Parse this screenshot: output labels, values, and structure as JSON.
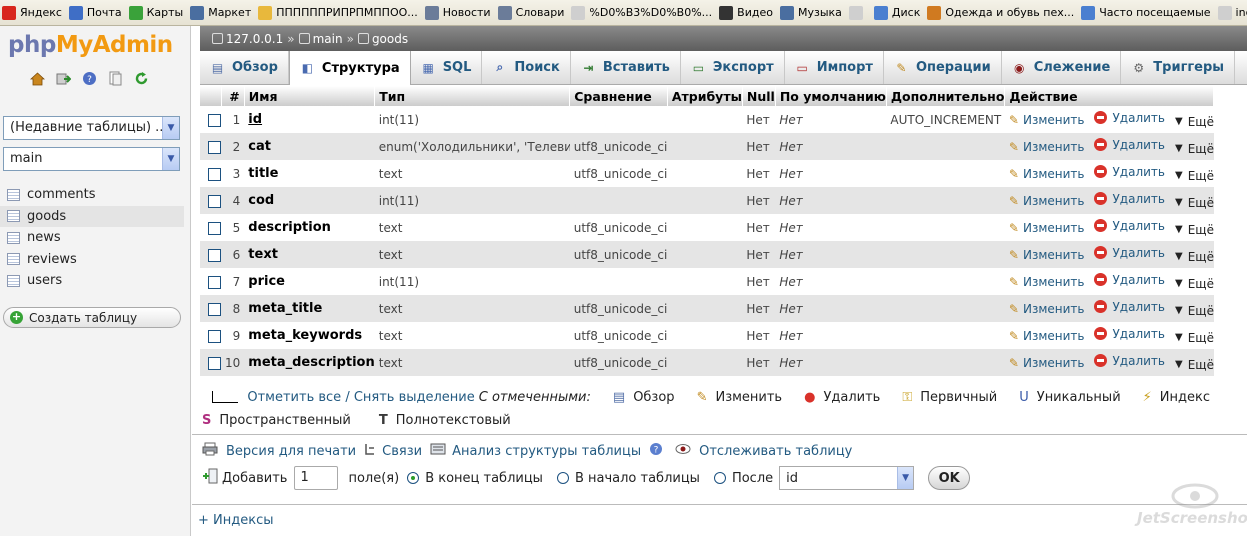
{
  "bookmarks": [
    {
      "label": "Яндекс",
      "color": "#d8261c"
    },
    {
      "label": "Почта",
      "color": "#3f6ec6"
    },
    {
      "label": "Карты",
      "color": "#3aa23a"
    },
    {
      "label": "Маркет",
      "color": "#4a6ea0"
    },
    {
      "label": "ППППППРИПРПМППОО...",
      "color": "#e8b83c"
    },
    {
      "label": "Новости",
      "color": "#6b7c99"
    },
    {
      "label": "Словари",
      "color": "#6b7c99"
    },
    {
      "label": "%D0%B3%D0%B0%...",
      "color": "#cfcfcf"
    },
    {
      "label": "Видео",
      "color": "#333333"
    },
    {
      "label": "Музыка",
      "color": "#4a6ea0"
    },
    {
      "label": "",
      "color": "#cfcfcf"
    },
    {
      "label": "Диск",
      "color": "#4a7fd0"
    },
    {
      "label": "Одежда и обувь пех...",
      "color": "#d07a20"
    },
    {
      "label": "Часто посещаемые",
      "color": "#4a7fd0"
    },
    {
      "label": "index.html",
      "color": "#cfcfcf"
    }
  ],
  "leftnav": {
    "logo_php": "php",
    "logo_admin": "MyAdmin",
    "recent_select": "(Недавние таблицы) ...",
    "db_select": "main",
    "tables": [
      "comments",
      "goods",
      "news",
      "reviews",
      "users"
    ],
    "active_table": "goods",
    "create_table": "Создать таблицу"
  },
  "breadcrumb": {
    "server": "127.0.0.1",
    "db": "main",
    "table": "goods"
  },
  "tabs": [
    {
      "label": "Обзор",
      "icon": "browse-icon"
    },
    {
      "label": "Структура",
      "icon": "structure-icon"
    },
    {
      "label": "SQL",
      "icon": "sql-icon"
    },
    {
      "label": "Поиск",
      "icon": "search-icon"
    },
    {
      "label": "Вставить",
      "icon": "insert-icon"
    },
    {
      "label": "Экспорт",
      "icon": "export-icon"
    },
    {
      "label": "Импорт",
      "icon": "import-icon"
    },
    {
      "label": "Операции",
      "icon": "operations-icon"
    },
    {
      "label": "Слежение",
      "icon": "tracking-icon"
    },
    {
      "label": "Триггеры",
      "icon": "triggers-icon"
    }
  ],
  "active_tab": "Структура",
  "table": {
    "headers": [
      "#",
      "Имя",
      "Тип",
      "Сравнение",
      "Атрибуты",
      "Null",
      "По умолчанию",
      "Дополнительно",
      "Действие"
    ],
    "rows": [
      {
        "num": "1",
        "name": "id",
        "type": "int(11)",
        "collation": "",
        "attributes": "",
        "null": "Нет",
        "default": "Нет",
        "extra": "AUTO_INCREMENT"
      },
      {
        "num": "2",
        "name": "cat",
        "type": "enum('Холодильники', 'Телевизо",
        "collation": "utf8_unicode_ci",
        "attributes": "",
        "null": "Нет",
        "default": "Нет",
        "extra": ""
      },
      {
        "num": "3",
        "name": "title",
        "type": "text",
        "collation": "utf8_unicode_ci",
        "attributes": "",
        "null": "Нет",
        "default": "Нет",
        "extra": ""
      },
      {
        "num": "4",
        "name": "cod",
        "type": "int(11)",
        "collation": "",
        "attributes": "",
        "null": "Нет",
        "default": "Нет",
        "extra": ""
      },
      {
        "num": "5",
        "name": "description",
        "type": "text",
        "collation": "utf8_unicode_ci",
        "attributes": "",
        "null": "Нет",
        "default": "Нет",
        "extra": ""
      },
      {
        "num": "6",
        "name": "text",
        "type": "text",
        "collation": "utf8_unicode_ci",
        "attributes": "",
        "null": "Нет",
        "default": "Нет",
        "extra": ""
      },
      {
        "num": "7",
        "name": "price",
        "type": "int(11)",
        "collation": "",
        "attributes": "",
        "null": "Нет",
        "default": "Нет",
        "extra": ""
      },
      {
        "num": "8",
        "name": "meta_title",
        "type": "text",
        "collation": "utf8_unicode_ci",
        "attributes": "",
        "null": "Нет",
        "default": "Нет",
        "extra": ""
      },
      {
        "num": "9",
        "name": "meta_keywords",
        "type": "text",
        "collation": "utf8_unicode_ci",
        "attributes": "",
        "null": "Нет",
        "default": "Нет",
        "extra": ""
      },
      {
        "num": "10",
        "name": "meta_description",
        "type": "text",
        "collation": "utf8_unicode_ci",
        "attributes": "",
        "null": "Нет",
        "default": "Нет",
        "extra": ""
      }
    ],
    "actions": {
      "change": "Изменить",
      "drop": "Удалить",
      "more": "Ещё"
    }
  },
  "with_selected": {
    "check_all": "Отметить все / Снять выделение",
    "with_selected": "С отмеченными:",
    "buttons": [
      "Обзор",
      "Изменить",
      "Удалить",
      "Первичный",
      "Уникальный",
      "Индекс"
    ],
    "buttons_row2": [
      "Пространственный",
      "Полнотекстовый"
    ]
  },
  "links": {
    "print": "Версия для печати",
    "relations": "Связи",
    "analyze": "Анализ структуры таблицы",
    "track": "Отслеживать таблицу"
  },
  "add": {
    "label": "Добавить",
    "count": "1",
    "fields": "поле(я)",
    "at_end": "В конец таблицы",
    "at_begin": "В начало таблицы",
    "after": "После",
    "after_field": "id",
    "ok": "OK"
  },
  "indexes": "+ Индексы",
  "watermark": "JetScreenshot"
}
